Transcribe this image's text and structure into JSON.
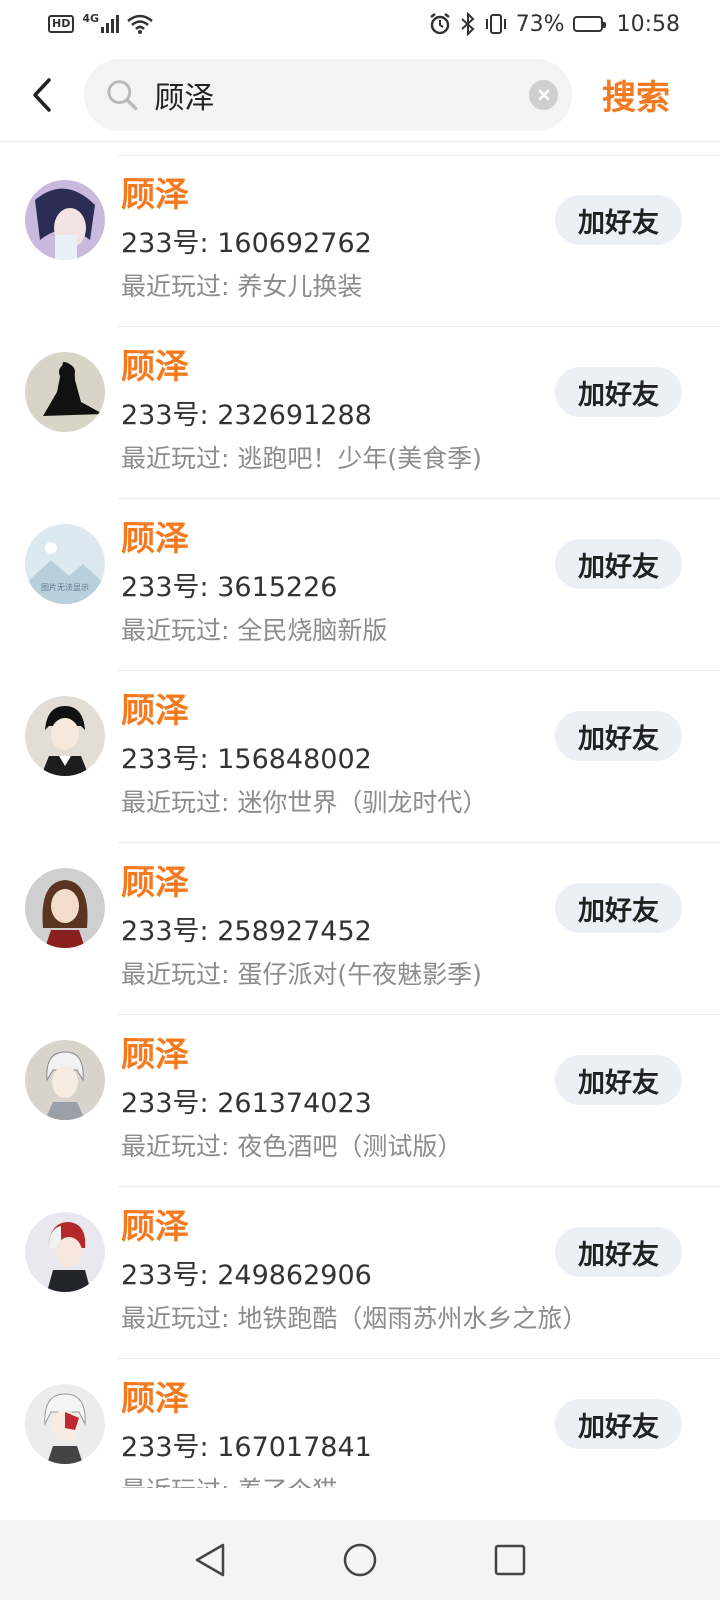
{
  "status_bar": {
    "hd": "HD",
    "network": "4G",
    "battery": "73%",
    "battery_level": 0.73,
    "time": "10:58"
  },
  "header": {
    "search_value": "顾泽",
    "search_button": "搜索"
  },
  "results": [
    {
      "name": "顾泽",
      "id_text": "233号: 160692762",
      "recent": "最近玩过: 养女儿换装",
      "button": "加好友",
      "avatar_bg": "#c9b9dd"
    },
    {
      "name": "顾泽",
      "id_text": "233号: 232691288",
      "recent": "最近玩过: 逃跑吧！少年(美食季)",
      "button": "加好友",
      "avatar_bg": "#d9d4c8"
    },
    {
      "name": "顾泽",
      "id_text": "233号: 3615226",
      "recent": "最近玩过: 全民烧脑新版",
      "button": "加好友",
      "avatar_bg": "#dce9f0",
      "avatar_text": "图片无法显示"
    },
    {
      "name": "顾泽",
      "id_text": "233号: 156848002",
      "recent": "最近玩过: 迷你世界（驯龙时代）",
      "button": "加好友",
      "avatar_bg": "#e3ddd6"
    },
    {
      "name": "顾泽",
      "id_text": "233号: 258927452",
      "recent": "最近玩过: 蛋仔派对(午夜魅影季)",
      "button": "加好友",
      "avatar_bg": "#cfcfcf"
    },
    {
      "name": "顾泽",
      "id_text": "233号: 261374023",
      "recent": "最近玩过: 夜色酒吧（测试版）",
      "button": "加好友",
      "avatar_bg": "#d8d4cc"
    },
    {
      "name": "顾泽",
      "id_text": "233号: 249862906",
      "recent": "最近玩过: 地铁跑酷（烟雨苏州水乡之旅）",
      "button": "加好友",
      "avatar_bg": "#e8e8ee"
    },
    {
      "name": "顾泽",
      "id_text": "233号: 167017841",
      "recent": "最近玩过: 养了个猫",
      "button": "加好友",
      "avatar_bg": "#ececec"
    }
  ],
  "colors": {
    "accent": "#f57a1f",
    "button_bg": "#eceff5"
  }
}
